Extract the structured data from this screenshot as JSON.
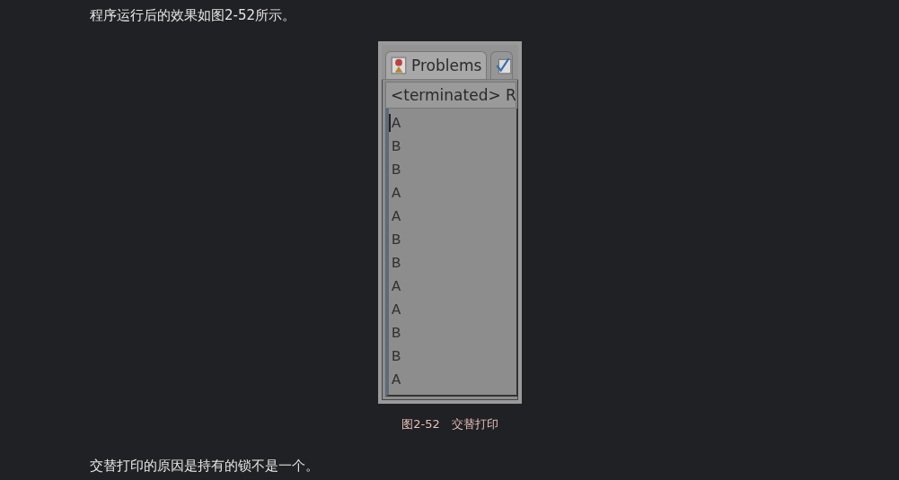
{
  "intro": "程序运行后的效果如图2-52所示。",
  "figure": {
    "tabs": [
      {
        "label": "Problems",
        "selected": true
      },
      {
        "selected": false
      }
    ],
    "console_header": "<terminated> R",
    "lines": [
      "A",
      "B",
      "B",
      "A",
      "A",
      "B",
      "B",
      "A",
      "A",
      "B",
      "B",
      "A"
    ]
  },
  "caption": "图2-52　交替打印",
  "outro": "交替打印的原因是持有的锁不是一个。"
}
